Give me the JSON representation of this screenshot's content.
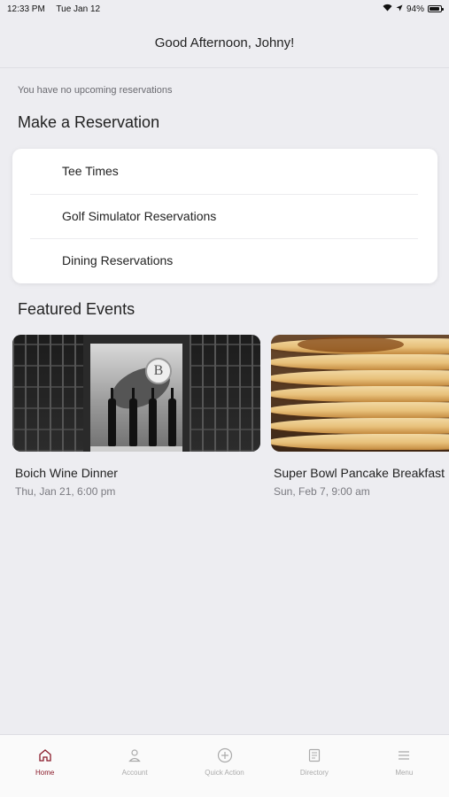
{
  "status_bar": {
    "time": "12:33 PM",
    "date": "Tue Jan 12",
    "battery": "94%",
    "battery_level": 0.94
  },
  "header": {
    "greeting": "Good Afternoon, Johny!"
  },
  "reservations": {
    "empty_message": "You have no upcoming reservations",
    "section_title": "Make a Reservation",
    "items": [
      {
        "label": "Tee Times"
      },
      {
        "label": "Golf Simulator Reservations"
      },
      {
        "label": "Dining Reservations"
      }
    ]
  },
  "featured": {
    "section_title": "Featured Events",
    "events": [
      {
        "title": "Boich Wine Dinner",
        "date": "Thu, Jan 21, 6:00 pm",
        "logo_letter": "B"
      },
      {
        "title": "Super Bowl Pancake Breakfast",
        "date": "Sun, Feb 7, 9:00 am"
      }
    ]
  },
  "tab_bar": {
    "accent_color": "#8a1a2a",
    "tabs": [
      {
        "label": "Home",
        "icon": "home-icon",
        "active": true
      },
      {
        "label": "Account",
        "icon": "account-icon",
        "active": false
      },
      {
        "label": "Quick Action",
        "icon": "plus-circle-icon",
        "active": false
      },
      {
        "label": "Directory",
        "icon": "directory-icon",
        "active": false
      },
      {
        "label": "Menu",
        "icon": "hamburger-menu-icon",
        "active": false
      }
    ]
  }
}
